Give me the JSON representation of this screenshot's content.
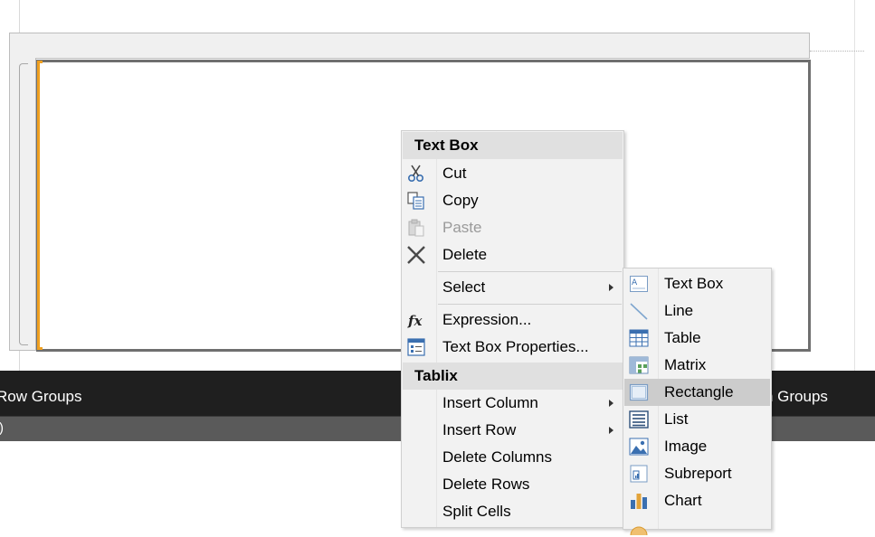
{
  "context_menu": {
    "header_textbox": "Text Box",
    "items_textbox": [
      {
        "label": "Cut",
        "icon": "scissors-icon",
        "enabled": true
      },
      {
        "label": "Copy",
        "icon": "copy-icon",
        "enabled": true
      },
      {
        "label": "Paste",
        "icon": "paste-icon",
        "enabled": false
      },
      {
        "label": "Delete",
        "icon": "delete-x-icon",
        "enabled": true
      }
    ],
    "select_label": "Select",
    "expression_label": "Expression...",
    "textbox_properties_label": "Text Box Properties...",
    "header_tablix": "Tablix",
    "items_tablix": [
      {
        "label": "Insert Column",
        "has_submenu": true
      },
      {
        "label": "Insert Row",
        "has_submenu": true
      },
      {
        "label": "Delete Columns",
        "has_submenu": false
      },
      {
        "label": "Delete Rows",
        "has_submenu": false
      },
      {
        "label": "Split Cells",
        "has_submenu": false
      }
    ]
  },
  "submenu": {
    "items": [
      {
        "label": "Text Box",
        "icon": "textbox-icon"
      },
      {
        "label": "Line",
        "icon": "line-icon"
      },
      {
        "label": "Table",
        "icon": "table-icon"
      },
      {
        "label": "Matrix",
        "icon": "matrix-icon"
      },
      {
        "label": "Rectangle",
        "icon": "rectangle-icon",
        "highlighted": true
      },
      {
        "label": "List",
        "icon": "list-icon"
      },
      {
        "label": "Image",
        "icon": "image-icon"
      },
      {
        "label": "Subreport",
        "icon": "subreport-icon"
      },
      {
        "label": "Chart",
        "icon": "chart-icon"
      }
    ]
  },
  "grouping_pane": {
    "row_groups_label": "Row Groups",
    "column_groups_label": "n Groups",
    "sub_text": ")"
  },
  "colors": {
    "selection_accent": "#f0a020",
    "menu_background": "#f2f2f2",
    "menu_header_background": "#e0e0e0",
    "menu_highlight": "#cccccc",
    "grouping_bar": "#1f1f1f"
  }
}
